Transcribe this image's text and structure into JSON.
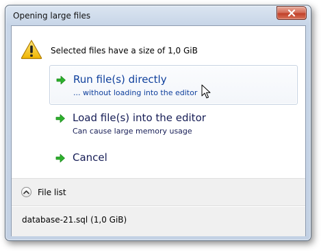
{
  "window": {
    "title": "Opening large files"
  },
  "content": {
    "message": "Selected files have a size of 1,0 GiB"
  },
  "commands": [
    {
      "label": "Run file(s) directly",
      "note": "... without loading into the editor"
    },
    {
      "label": "Load file(s) into the editor",
      "note": "Can cause large memory usage"
    },
    {
      "label": "Cancel"
    }
  ],
  "footer": {
    "expando_label": "File list",
    "file_list_text": "database-21.sql (1,0 GiB)"
  },
  "icons": {
    "main": "warning-icon",
    "command": "green-arrow-icon",
    "close": "close-icon",
    "expando": "chevron-up-icon"
  },
  "colors": {
    "command_text": "#151c55",
    "command_text_hover": "#0e3f9c",
    "arrow_green": "#2db22d",
    "warning_yellow": "#f5c518",
    "close_red": "#c0412a"
  }
}
